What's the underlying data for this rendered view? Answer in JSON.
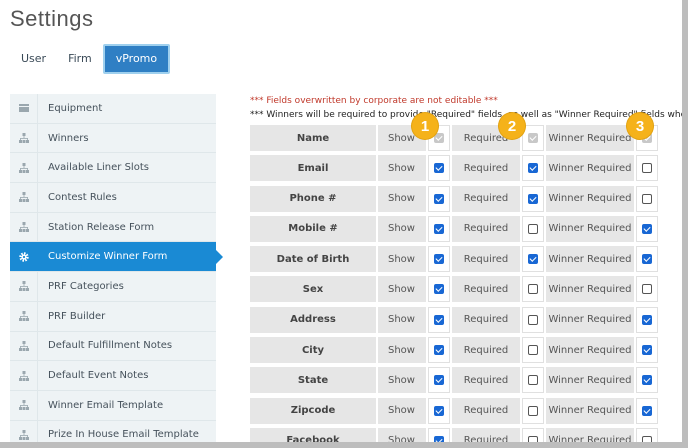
{
  "page": {
    "title": "Settings"
  },
  "tabs": [
    {
      "label": "User",
      "active": false
    },
    {
      "label": "Firm",
      "active": false
    },
    {
      "label": "vPromo",
      "active": true
    }
  ],
  "sidebar": {
    "items": [
      {
        "label": "Equipment",
        "icon": "equipment-icon",
        "active": false
      },
      {
        "label": "Winners",
        "icon": "sitemap-icon",
        "active": false
      },
      {
        "label": "Available Liner Slots",
        "icon": "sitemap-icon",
        "active": false
      },
      {
        "label": "Contest Rules",
        "icon": "sitemap-icon",
        "active": false
      },
      {
        "label": "Station Release Form",
        "icon": "sitemap-icon",
        "active": false
      },
      {
        "label": "Customize Winner Form",
        "icon": "gear-icon",
        "active": true
      },
      {
        "label": "PRF Categories",
        "icon": "sitemap-icon",
        "active": false
      },
      {
        "label": "PRF Builder",
        "icon": "sitemap-icon",
        "active": false
      },
      {
        "label": "Default Fulfillment Notes",
        "icon": "sitemap-icon",
        "active": false
      },
      {
        "label": "Default Event Notes",
        "icon": "sitemap-icon",
        "active": false
      },
      {
        "label": "Winner Email Template",
        "icon": "sitemap-icon",
        "active": false
      },
      {
        "label": "Prize In House Email Template",
        "icon": "sitemap-icon",
        "active": false
      }
    ]
  },
  "notes": {
    "corporate": "*** Fields overwritten by corporate are not editable ***",
    "winners": "*** Winners will be required to provide \"Required\" fields, as well as \"Winner Required\" fields when usi"
  },
  "labels": {
    "show": "Show",
    "required": "Required",
    "winner_required": "Winner Required"
  },
  "badges": [
    "1",
    "2",
    "3"
  ],
  "colors": {
    "accent": "#1a8ad4",
    "badge": "#f5b21a",
    "note_red": "#c0392b"
  },
  "fields": [
    {
      "name": "Name",
      "show": "disabled",
      "required": "disabled",
      "winner_required": "disabled"
    },
    {
      "name": "Email",
      "show": true,
      "required": true,
      "winner_required": false
    },
    {
      "name": "Phone #",
      "show": true,
      "required": true,
      "winner_required": false
    },
    {
      "name": "Mobile #",
      "show": true,
      "required": false,
      "winner_required": true
    },
    {
      "name": "Date of Birth",
      "show": true,
      "required": true,
      "winner_required": true
    },
    {
      "name": "Sex",
      "show": true,
      "required": false,
      "winner_required": false
    },
    {
      "name": "Address",
      "show": true,
      "required": false,
      "winner_required": true
    },
    {
      "name": "City",
      "show": true,
      "required": false,
      "winner_required": true
    },
    {
      "name": "State",
      "show": true,
      "required": false,
      "winner_required": true
    },
    {
      "name": "Zipcode",
      "show": true,
      "required": false,
      "winner_required": true
    },
    {
      "name": "Facebook",
      "show": true,
      "required": false,
      "winner_required": false
    }
  ]
}
